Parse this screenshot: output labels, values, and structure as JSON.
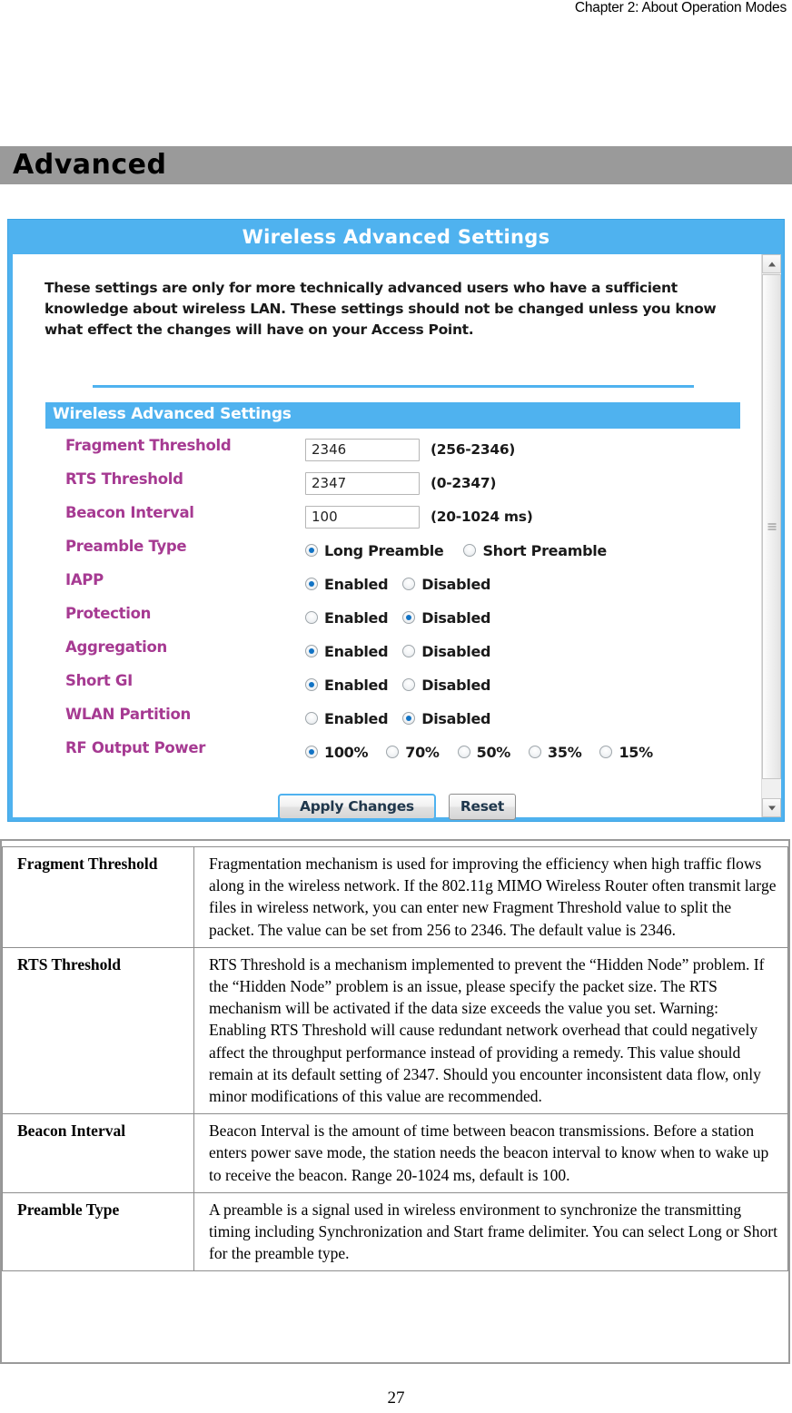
{
  "page": {
    "running_header": "Chapter 2: About Operation Modes",
    "section_title": "Advanced",
    "page_number": "27"
  },
  "ui": {
    "window_title": "Wireless Advanced Settings",
    "intro": "These settings are only for more technically advanced users who have a sufficient knowledge about wireless LAN. These settings should not be changed unless you know what effect the changes will have on your Access Point.",
    "subsection_title": "Wireless Advanced Settings",
    "fields": {
      "fragment_threshold": {
        "label": "Fragment Threshold",
        "value": "2346",
        "hint": "(256-2346)"
      },
      "rts_threshold": {
        "label": "RTS Threshold",
        "value": "2347",
        "hint": "(0-2347)"
      },
      "beacon_interval": {
        "label": "Beacon Interval",
        "value": "100",
        "hint": "(20-1024 ms)"
      },
      "preamble_type": {
        "label": "Preamble Type",
        "options": [
          "Long Preamble",
          "Short Preamble"
        ],
        "selected": "Long Preamble"
      },
      "iapp": {
        "label": "IAPP",
        "options": [
          "Enabled",
          "Disabled"
        ],
        "selected": "Enabled"
      },
      "protection": {
        "label": "Protection",
        "options": [
          "Enabled",
          "Disabled"
        ],
        "selected": "Disabled"
      },
      "aggregation": {
        "label": "Aggregation",
        "options": [
          "Enabled",
          "Disabled"
        ],
        "selected": "Enabled"
      },
      "short_gi": {
        "label": "Short GI",
        "options": [
          "Enabled",
          "Disabled"
        ],
        "selected": "Enabled"
      },
      "wlan_partition": {
        "label": "WLAN Partition",
        "options": [
          "Enabled",
          "Disabled"
        ],
        "selected": "Disabled"
      },
      "rf_output_power": {
        "label": "RF Output Power",
        "options": [
          "100%",
          "70%",
          "50%",
          "35%",
          "15%"
        ],
        "selected": "100%"
      }
    },
    "buttons": {
      "apply": "Apply Changes",
      "reset": "Reset"
    },
    "colors": {
      "accent_blue": "#4fb2ef",
      "label_purple": "#a63a92",
      "radio_dot": "#1273c4",
      "banner_grey": "#9a9a9a"
    }
  },
  "description_table": {
    "rows": [
      {
        "term": "Fragment Threshold",
        "definition": "Fragmentation mechanism is used for improving the efficiency when high traffic flows along in the wireless network. If the 802.11g MIMO Wireless Router often transmit large files in wireless network, you can enter new Fragment Threshold value to split the packet.  The value can be set from 256 to 2346. The default value is 2346."
      },
      {
        "term": "RTS Threshold",
        "definition": "RTS Threshold is a mechanism implemented to prevent the “Hidden Node” problem. If the “Hidden Node” problem is an issue, please specify the packet size. The RTS mechanism will be activated if the data size exceeds the value you set.\nWarning: Enabling RTS Threshold will cause redundant network overhead that could negatively affect the throughput performance instead of providing a remedy.\nThis value should remain at its default setting of 2347.  Should you encounter inconsistent data flow, only minor modifications of this value are recommended."
      },
      {
        "term": "Beacon Interval",
        "definition": "Beacon Interval is the amount of time between beacon transmissions. Before a station enters power save mode, the station needs the beacon interval to know when to wake up to receive the beacon. Range 20-1024 ms, default is 100."
      },
      {
        "term": "Preamble Type",
        "definition": "A preamble is a signal used in wireless environment to synchronize the transmitting timing including Synchronization and Start frame delimiter. You can select Long or Short for the preamble type."
      }
    ]
  }
}
